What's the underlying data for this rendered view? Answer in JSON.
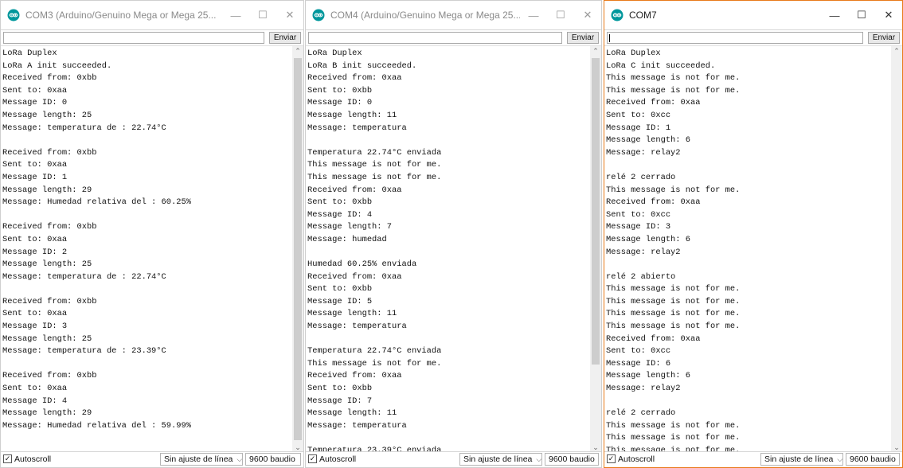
{
  "windows": [
    {
      "title": "COM3 (Arduino/Genuino Mega or Mega 25...",
      "send_label": "Enviar",
      "input_value": "",
      "autoscroll_label": "Autoscroll",
      "autoscroll_checked": true,
      "line_ending": "Sin ajuste de línea",
      "baud": "9600 baudio",
      "lines": [
        "LoRa Duplex",
        "LoRa A init succeeded.",
        "Received from: 0xbb",
        "Sent to: 0xaa",
        "Message ID: 0",
        "Message length: 25",
        "Message: temperatura de : 22.74°C",
        "",
        "Received from: 0xbb",
        "Sent to: 0xaa",
        "Message ID: 1",
        "Message length: 29",
        "Message: Humedad relativa del : 60.25%",
        "",
        "Received from: 0xbb",
        "Sent to: 0xaa",
        "Message ID: 2",
        "Message length: 25",
        "Message: temperatura de : 22.74°C",
        "",
        "Received from: 0xbb",
        "Sent to: 0xaa",
        "Message ID: 3",
        "Message length: 25",
        "Message: temperatura de : 23.39°C",
        "",
        "Received from: 0xbb",
        "Sent to: 0xaa",
        "Message ID: 4",
        "Message length: 29",
        "Message: Humedad relativa del : 59.99%"
      ]
    },
    {
      "title": "COM4 (Arduino/Genuino Mega or Mega 25...",
      "send_label": "Enviar",
      "input_value": "",
      "autoscroll_label": "Autoscroll",
      "autoscroll_checked": true,
      "line_ending": "Sin ajuste de línea",
      "baud": "9600 baudio",
      "lines": [
        "LoRa Duplex",
        "LoRa B init succeeded.",
        "Received from: 0xaa",
        "Sent to: 0xbb",
        "Message ID: 0",
        "Message length: 11",
        "Message: temperatura",
        "",
        "Temperatura 22.74°C enviada",
        "This message is not for me.",
        "This message is not for me.",
        "Received from: 0xaa",
        "Sent to: 0xbb",
        "Message ID: 4",
        "Message length: 7",
        "Message: humedad",
        "",
        "Humedad 60.25% enviada",
        "Received from: 0xaa",
        "Sent to: 0xbb",
        "Message ID: 5",
        "Message length: 11",
        "Message: temperatura",
        "",
        "Temperatura 22.74°C enviada",
        "This message is not for me.",
        "Received from: 0xaa",
        "Sent to: 0xbb",
        "Message ID: 7",
        "Message length: 11",
        "Message: temperatura",
        "",
        "Temperatura 23.39°C enviada"
      ]
    },
    {
      "title": "COM7",
      "send_label": "Enviar",
      "input_value": "",
      "autoscroll_label": "Autoscroll",
      "autoscroll_checked": true,
      "line_ending": "Sin ajuste de línea",
      "baud": "9600 baudio",
      "lines": [
        "LoRa Duplex",
        "LoRa C init succeeded.",
        "This message is not for me.",
        "This message is not for me.",
        "Received from: 0xaa",
        "Sent to: 0xcc",
        "Message ID: 1",
        "Message length: 6",
        "Message: relay2",
        "",
        "relé 2 cerrado",
        "This message is not for me.",
        "Received from: 0xaa",
        "Sent to: 0xcc",
        "Message ID: 3",
        "Message length: 6",
        "Message: relay2",
        "",
        "relé 2 abierto",
        "This message is not for me.",
        "This message is not for me.",
        "This message is not for me.",
        "This message is not for me.",
        "Received from: 0xaa",
        "Sent to: 0xcc",
        "Message ID: 6",
        "Message length: 6",
        "Message: relay2",
        "",
        "relé 2 cerrado",
        "This message is not for me.",
        "This message is not for me.",
        "This message is not for me."
      ]
    }
  ],
  "icons": {
    "app": "arduino-logo-icon",
    "minimize": "minimize-icon",
    "maximize": "maximize-icon",
    "close": "close-icon",
    "scroll_up": "chevron-up-icon",
    "scroll_down": "chevron-down-icon",
    "dropdown": "chevron-down-icon"
  },
  "colors": {
    "arduino_teal": "#00979c",
    "active_border": "#e87a1a"
  }
}
